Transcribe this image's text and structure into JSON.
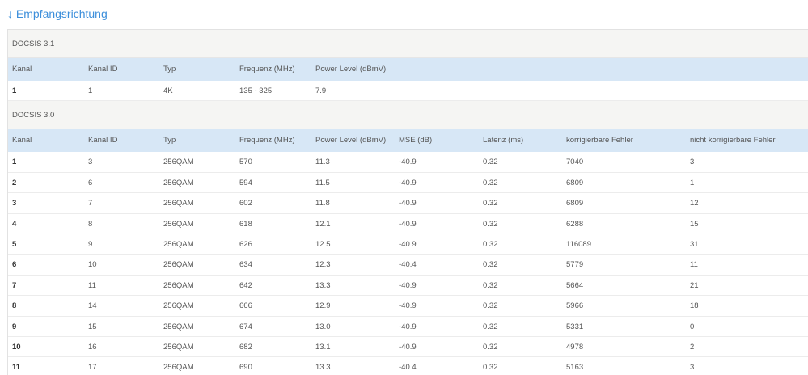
{
  "title": "↓ Empfangsrichtung",
  "docsis31": {
    "label": "DOCSIS 3.1",
    "headers": [
      "Kanal",
      "Kanal ID",
      "Typ",
      "Frequenz (MHz)",
      "Power Level (dBmV)"
    ],
    "rows": [
      [
        "1",
        "1",
        "4K",
        "135 - 325",
        "7.9"
      ]
    ]
  },
  "docsis30": {
    "label": "DOCSIS 3.0",
    "headers": [
      "Kanal",
      "Kanal ID",
      "Typ",
      "Frequenz (MHz)",
      "Power Level (dBmV)",
      "MSE (dB)",
      "Latenz (ms)",
      "korrigierbare Fehler",
      "nicht korrigierbare Fehler"
    ],
    "rows": [
      [
        "1",
        "3",
        "256QAM",
        "570",
        "11.3",
        "-40.9",
        "0.32",
        "7040",
        "3"
      ],
      [
        "2",
        "6",
        "256QAM",
        "594",
        "11.5",
        "-40.9",
        "0.32",
        "6809",
        "1"
      ],
      [
        "3",
        "7",
        "256QAM",
        "602",
        "11.8",
        "-40.9",
        "0.32",
        "6809",
        "12"
      ],
      [
        "4",
        "8",
        "256QAM",
        "618",
        "12.1",
        "-40.9",
        "0.32",
        "6288",
        "15"
      ],
      [
        "5",
        "9",
        "256QAM",
        "626",
        "12.5",
        "-40.9",
        "0.32",
        "116089",
        "31"
      ],
      [
        "6",
        "10",
        "256QAM",
        "634",
        "12.3",
        "-40.4",
        "0.32",
        "5779",
        "11"
      ],
      [
        "7",
        "11",
        "256QAM",
        "642",
        "13.3",
        "-40.9",
        "0.32",
        "5664",
        "21"
      ],
      [
        "8",
        "14",
        "256QAM",
        "666",
        "12.9",
        "-40.9",
        "0.32",
        "5966",
        "18"
      ],
      [
        "9",
        "15",
        "256QAM",
        "674",
        "13.0",
        "-40.9",
        "0.32",
        "5331",
        "0"
      ],
      [
        "10",
        "16",
        "256QAM",
        "682",
        "13.1",
        "-40.9",
        "0.32",
        "4978",
        "2"
      ],
      [
        "11",
        "17",
        "256QAM",
        "690",
        "13.3",
        "-40.4",
        "0.32",
        "5163",
        "3"
      ]
    ]
  }
}
